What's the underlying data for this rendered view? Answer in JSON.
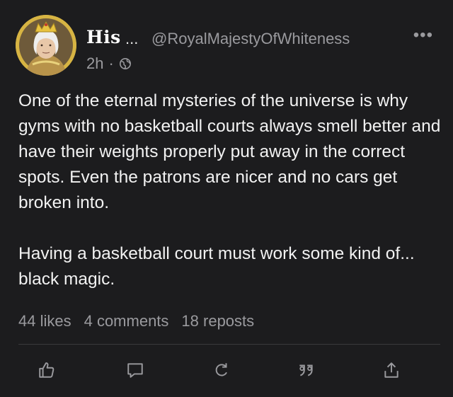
{
  "post": {
    "author_short": "His",
    "name_ellipsis": "...",
    "handle": "@RoyalMajestyOfWhiteness",
    "more_label": "•••",
    "time": "2h",
    "separator": "·",
    "paragraphs": [
      "One of the eternal mysteries of the universe is why gyms with no basketball courts always smell better and have their weights properly put away in the correct spots. Even the patrons are nicer and no cars get broken into.",
      "Having a basketball court must work some kind of... black magic."
    ],
    "stats": {
      "likes": "44 likes",
      "comments": "4 comments",
      "reposts": "18 reposts"
    }
  },
  "icons": {
    "like": "thumbs-up-icon",
    "comment": "comment-icon",
    "repost": "repost-icon",
    "quote": "quote-icon",
    "share": "share-icon",
    "visibility": "globe-icon"
  },
  "colors": {
    "background": "#1c1c1e",
    "text": "#f2f2f2",
    "muted": "#9a9a9e",
    "divider": "#3a3a3c"
  }
}
